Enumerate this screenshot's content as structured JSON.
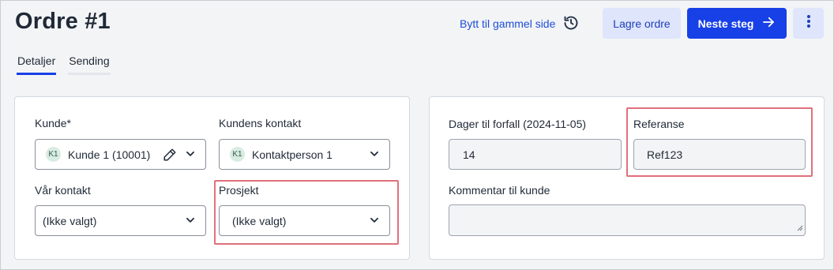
{
  "header": {
    "title": "Ordre #1",
    "switch_link": "Bytt til gammel side",
    "save_label": "Lagre ordre",
    "next_label": "Neste steg"
  },
  "tabs": [
    {
      "label": "Detaljer",
      "active": true
    },
    {
      "label": "Sending",
      "active": false
    }
  ],
  "left_card": {
    "customer": {
      "label": "Kunde*",
      "badge": "K1",
      "value": "Kunde 1 (10001)"
    },
    "customer_contact": {
      "label": "Kundens kontakt",
      "badge": "K1",
      "value": "Kontaktperson 1"
    },
    "our_contact": {
      "label": "Vår kontakt",
      "value": "(Ikke valgt)"
    },
    "project": {
      "label": "Prosjekt",
      "value": "(Ikke valgt)"
    }
  },
  "right_card": {
    "due_days": {
      "label": "Dager til forfall (2024-11-05)",
      "value": "14"
    },
    "reference": {
      "label": "Referanse",
      "value": "Ref123"
    },
    "comment": {
      "label": "Kommentar til kunde",
      "value": ""
    }
  },
  "colors": {
    "primary": "#1740e6",
    "secondary_bg": "#dfe5fb",
    "highlight": "#e0707b",
    "link": "#1d4ed8"
  }
}
